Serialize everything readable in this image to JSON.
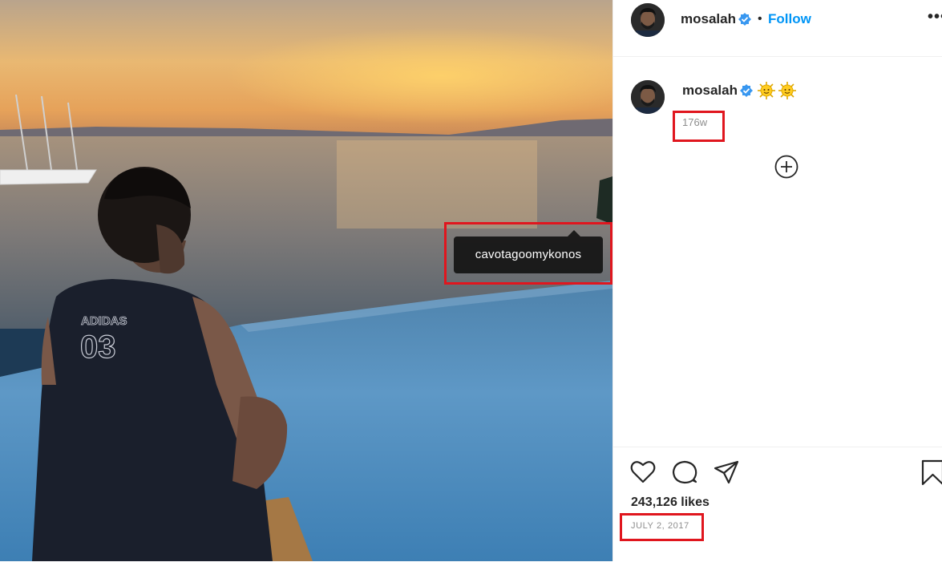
{
  "photo": {
    "shirt_brand": "ADIDAS",
    "shirt_number": "03",
    "tag_label": "cavotagoomykonos"
  },
  "header": {
    "username": "mosalah",
    "separator": "•",
    "follow_label": "Follow",
    "more_label": "•••"
  },
  "caption": {
    "username": "mosalah",
    "emojis": [
      "sun-face-emoji",
      "sun-face-emoji"
    ],
    "time_ago": "176w",
    "load_more_icon": "plus-circle-icon"
  },
  "actions": {
    "icons": [
      "heart-icon",
      "comment-icon",
      "share-icon",
      "bookmark-icon"
    ],
    "likes": "243,126 likes",
    "date": "JULY 2, 2017"
  },
  "colors": {
    "accent": "#0095f6",
    "verified": "#3897f0",
    "highlight": "#e0161e",
    "muted": "#8e8e8e"
  }
}
